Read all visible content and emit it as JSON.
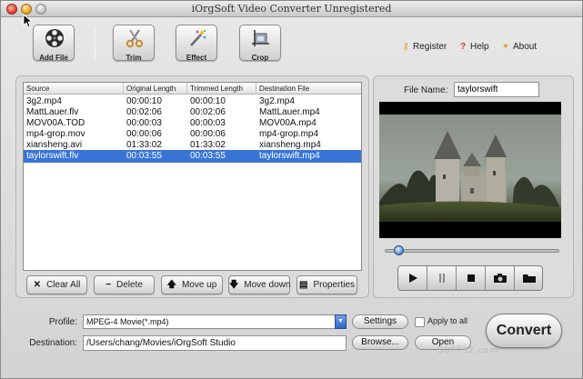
{
  "window": {
    "title": "iOrgSoft Video Converter Unregistered"
  },
  "toolbar": {
    "add_file": "Add File",
    "trim": "Trim",
    "effect": "Effect",
    "crop": "Crop",
    "register": "Register",
    "help": "Help",
    "about": "About"
  },
  "table": {
    "headers": [
      "Source",
      "Original Length",
      "Trimmed Length",
      "Destination File"
    ],
    "rows": [
      [
        "3g2.mp4",
        "00:00:10",
        "00:00:10",
        "3g2.mp4"
      ],
      [
        "MattLauer.flv",
        "00:02:06",
        "00:02:06",
        "MattLauer.mp4"
      ],
      [
        "MOV00A.TOD",
        "00:00:03",
        "00:00:03",
        "MOV00A.mp4"
      ],
      [
        "mp4-grop.mov",
        "00:00:06",
        "00:00:06",
        "mp4-grop.mp4"
      ],
      [
        "xiansheng.avi",
        "01:33:02",
        "01:33:02",
        "xiansheng.mp4"
      ],
      [
        "taylorswift.flv",
        "00:03:55",
        "00:03:55",
        "taylorswift.mp4"
      ]
    ],
    "selected_index": 5
  },
  "list_buttons": {
    "clear_all": "Clear All",
    "delete": "Delete",
    "move_up": "Move up",
    "move_down": "Move down",
    "properties": "Properties"
  },
  "preview": {
    "file_name_label": "File Name:",
    "file_name_value": "taylorswift",
    "playback_fraction": 0.05
  },
  "bottom": {
    "profile_label": "Profile:",
    "profile_value": "MPEG-4 Movie(*.mp4)",
    "settings": "Settings",
    "apply_to_all": "Apply to all",
    "destination_label": "Destination:",
    "destination_value": "/Users/chang/Movies/iOrgSoft Studio",
    "browse": "Browse...",
    "open": "Open",
    "convert": "Convert",
    "watermark": "SOFT32.com"
  },
  "colors": {
    "selection": "#3875d7",
    "accent": "#2f66c8"
  }
}
